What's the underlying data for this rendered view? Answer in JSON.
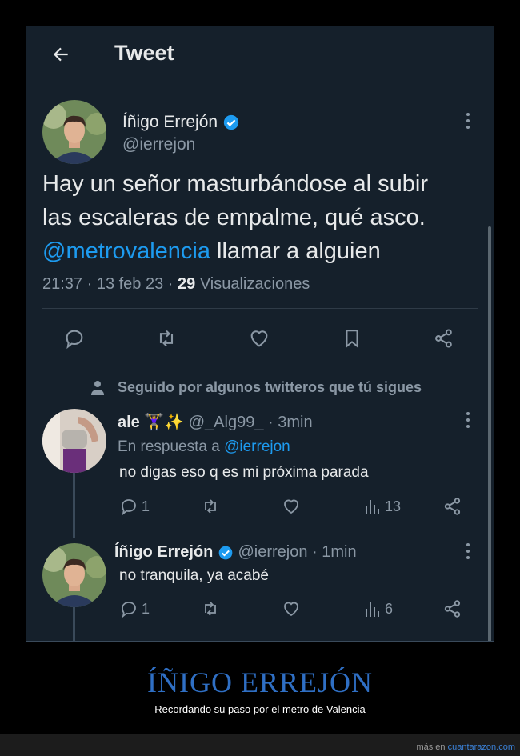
{
  "header": {
    "title": "Tweet"
  },
  "main_tweet": {
    "author_name": "Íñigo Errejón",
    "author_handle": "@ierrejon",
    "text_line1": "Hay un señor masturbándose al subir",
    "text_line2": "las escaleras de empalme, qué asco.",
    "mention": "@metrovalencia",
    "text_line3_rest": " llamar a alguien",
    "time": "21:37 · 13 feb 23 · ",
    "views_count": "29",
    "views_label": " Visualizaciones"
  },
  "followed_note": "Seguido por algunos twitteros que tú sigues",
  "replies": [
    {
      "author_name": "ale 🏋️‍♀️✨",
      "author_handle": "@_Alg99_",
      "time": "· 3min",
      "in_reply_prefix": "En respuesta a ",
      "in_reply_handle": "@ierrejon",
      "text": "no digas eso q es mi próxima parada",
      "reply_count": "1",
      "views_count": "13"
    },
    {
      "author_name": "Íñigo Errejón",
      "author_handle": "@ierrejon",
      "time": "· 1min",
      "text": "no tranquila, ya acabé",
      "reply_count": "1",
      "views_count": "6"
    }
  ],
  "footer": {
    "title": "ÍÑIGO ERREJÓN",
    "subtitle": "Recordando su paso por el metro de Valencia",
    "credit_prefix": "más en ",
    "credit_site": "cuantarazon.com"
  },
  "colors": {
    "background": "#15202b",
    "accent": "#1d9bf0",
    "muted": "#8b98a5",
    "footer_title": "#2f6fc4"
  }
}
